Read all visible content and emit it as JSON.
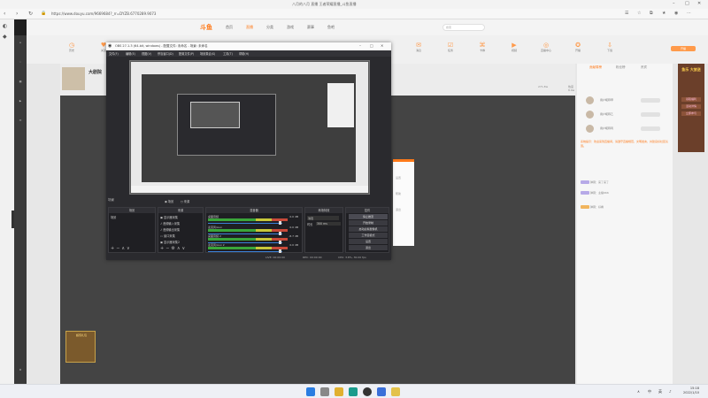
{
  "browser": {
    "title": "八月的八月 直播 王者荣耀直播_斗鱼直播",
    "url": "https://www.douyu.com/9669684?_rr=DYZB.6770289.9073"
  },
  "site": {
    "logo": "斗鱼",
    "nav": [
      "首页",
      "直播",
      "分类",
      "游戏",
      "赛事",
      "鱼吧"
    ],
    "search_placeholder": "搜索",
    "subnav": [
      "历史",
      "关注",
      "分区",
      "鱼吧",
      "动态",
      "消息",
      "任务",
      "卡券",
      "视频",
      "直播中心",
      "开播",
      "下载"
    ],
    "upload_btn": "开播",
    "streamer_name": "大剧院",
    "viewer_meta": "271.8w",
    "follower_meta": "热度 8.9w"
  },
  "chat": {
    "tabs": [
      "贡献周榜",
      "粉丝榜",
      "贵宾"
    ],
    "ranks": [
      "用户昵称甲",
      "用户昵称乙",
      "用户昵称丙"
    ],
    "messages": [
      "系统提示：欢迎来到直播间，请遵守直播规范，文明发言，共建良好社区氛围。",
      "弹幕：来了来了",
      "弹幕：主播666",
      "弹幕：好看"
    ]
  },
  "ads": {
    "right_title": "鱼乐 大放送",
    "right_lines": [
      "领取福利",
      "活动详情",
      "立即参与"
    ],
    "left_title": "超值礼包"
  },
  "popup": {
    "items": [
      "设置",
      "帮助",
      "退出"
    ]
  },
  "obs": {
    "title": "OBS 27.1.3 (64-bit, windows) - 配置文件: 未命名 - 场景: 未命名",
    "menu": [
      "文件(F)",
      "编辑(E)",
      "视图(V)",
      "停靠窗口(D)",
      "配置文件(P)",
      "场景集合(S)",
      "工具(T)",
      "帮助(H)"
    ],
    "scene_label": "场景",
    "radios": [
      "场景",
      "来源"
    ],
    "docks": {
      "scenes": "场景",
      "sources": "来源",
      "mixer": "混音器",
      "transitions": "转场特效",
      "controls": "控件"
    },
    "scene_items": [
      "场景"
    ],
    "source_items": [
      "显示器采集",
      "音频输入采集",
      "音频输出采集",
      "窗口采集",
      "显示器采集2"
    ],
    "mixer_channels": [
      {
        "name": "桌面音频",
        "db": "0.0 dB"
      },
      {
        "name": "麦克风/Aux",
        "db": "0.0 dB"
      },
      {
        "name": "桌面音频 2",
        "db": "-8.7 dB"
      },
      {
        "name": "麦克风/Aux 2",
        "db": "0.0 dB"
      }
    ],
    "trans": {
      "type": "淡出",
      "duration_label": "时长",
      "duration": "300 ms"
    },
    "controls": [
      "停止推流",
      "开始录制",
      "启动虚拟摄像机",
      "工作室模式",
      "设置",
      "退出"
    ],
    "status": {
      "live": "LIVE: 00:00:00",
      "rec": "REC: 00:00:00",
      "cpu": "CPU: 3.8%, 30.00 fps"
    }
  },
  "taskbar": {
    "time": "15:18",
    "date": "2022/1/10",
    "tray": [
      "∧",
      "中",
      "英"
    ]
  }
}
